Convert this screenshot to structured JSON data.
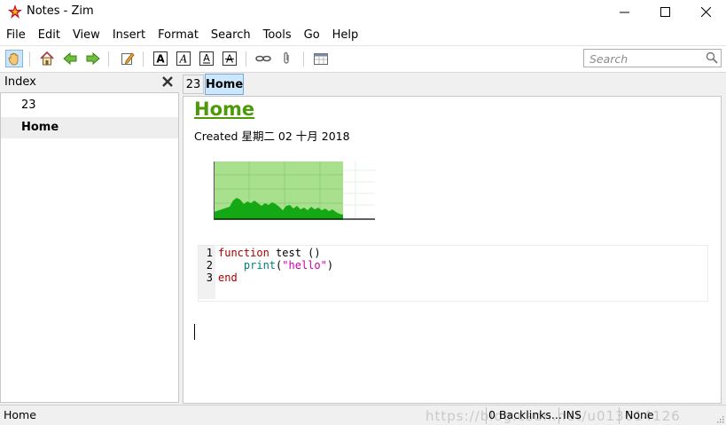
{
  "window": {
    "title": "Notes - Zim"
  },
  "menu": [
    "File",
    "Edit",
    "View",
    "Insert",
    "Format",
    "Search",
    "Tools",
    "Go",
    "Help"
  ],
  "toolbar": {
    "icons": [
      "hand-icon",
      "home-icon",
      "back-arrow-icon",
      "forward-arrow-icon",
      "edit-icon",
      "bold-icon",
      "italic-icon",
      "underline-icon",
      "strike-icon",
      "link-icon",
      "attach-icon",
      "calendar-icon"
    ]
  },
  "search": {
    "placeholder": "Search"
  },
  "index": {
    "header": "Index",
    "items": [
      {
        "label": "23"
      },
      {
        "label": "Home"
      }
    ]
  },
  "tabs": [
    "23",
    "Home"
  ],
  "page": {
    "title": "Home",
    "created": "Created 星期二 02 十月 2018",
    "code": {
      "line_numbers": [
        "1",
        "2",
        "3"
      ],
      "lines": [
        {
          "kw": "function",
          "rest": " test ()"
        },
        {
          "indent": "    ",
          "fn": "print",
          "open": "(",
          "str": "\"hello\"",
          "close": ")"
        },
        {
          "kw": "end"
        }
      ]
    }
  },
  "status": {
    "page": "Home",
    "backlinks": "0 Backlinks...",
    "mode": "INS",
    "style": "None",
    "watermark": "https://blog.csdn.net/u013614126"
  },
  "colors": {
    "title": "#4e9a06",
    "tab_active": "#cce8ff",
    "chart_fill": "#a8e08e",
    "chart_area": "#14a814"
  }
}
